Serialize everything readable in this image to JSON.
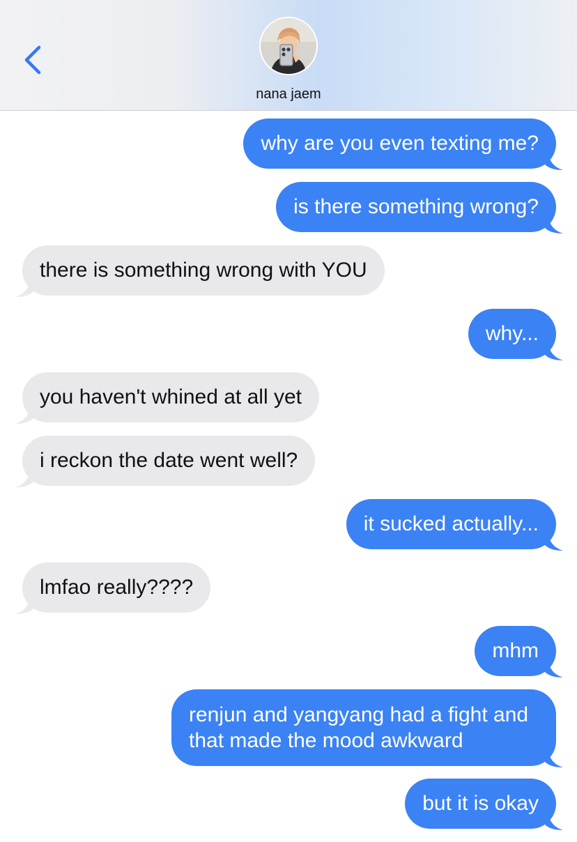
{
  "header": {
    "contact_name": "nana jaem",
    "back_icon": "chevron-left-icon",
    "accent_color": "#3478f6"
  },
  "colors": {
    "sent_bubble": "#3b82f4",
    "received_bubble": "#e9e9eb"
  },
  "messages": [
    {
      "direction": "sent",
      "text": "why are you even texting me?"
    },
    {
      "direction": "sent",
      "text": "is there something wrong?"
    },
    {
      "direction": "received",
      "text": "there is something wrong with YOU"
    },
    {
      "direction": "sent",
      "text": "why..."
    },
    {
      "direction": "received",
      "text": "you haven't whined at all yet"
    },
    {
      "direction": "received",
      "text": "i reckon the date went well?"
    },
    {
      "direction": "sent",
      "text": "it sucked actually..."
    },
    {
      "direction": "received",
      "text": "lmfao really????"
    },
    {
      "direction": "sent",
      "text": "mhm"
    },
    {
      "direction": "sent",
      "text": "renjun and yangyang had a fight and that made the mood awkward"
    },
    {
      "direction": "sent",
      "text": "but it is okay"
    }
  ]
}
